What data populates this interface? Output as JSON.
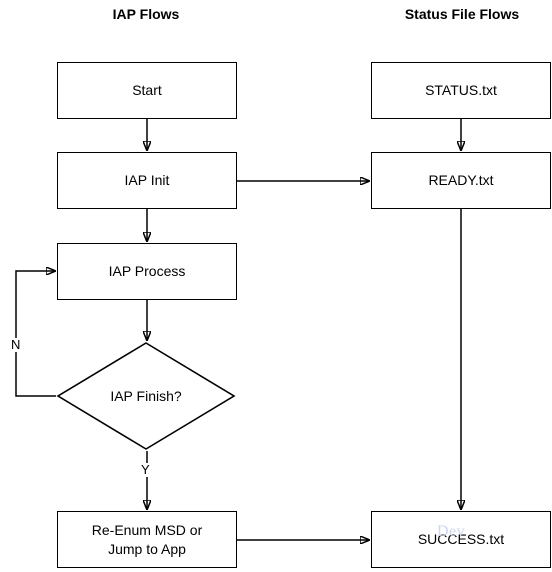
{
  "diagram": {
    "type": "flowchart",
    "background_color": "#ffffff",
    "stroke_color": "#000000",
    "columns": [
      {
        "id": "iap",
        "title": "IAP Flows"
      },
      {
        "id": "status",
        "title": "Status File Flows"
      }
    ],
    "nodes": {
      "start": {
        "label": "Start",
        "shape": "rectangle",
        "column": "iap"
      },
      "iap_init": {
        "label": "IAP Init",
        "shape": "rectangle",
        "column": "iap"
      },
      "iap_process": {
        "label": "IAP Process",
        "shape": "rectangle",
        "column": "iap"
      },
      "iap_finish": {
        "label": "IAP Finish?",
        "shape": "diamond",
        "column": "iap"
      },
      "reenum": {
        "label_line1": "Re-Enum MSD or",
        "label_line2": "Jump to App",
        "shape": "rectangle",
        "column": "iap"
      },
      "status_txt": {
        "label": "STATUS.txt",
        "shape": "rectangle",
        "column": "status"
      },
      "ready_txt": {
        "label": "READY.txt",
        "shape": "rectangle",
        "column": "status"
      },
      "success_txt": {
        "label": "SUCCESS.txt",
        "shape": "rectangle",
        "column": "status"
      }
    },
    "edge_labels": {
      "no": "N",
      "yes": "Y"
    },
    "watermark": "Dev"
  }
}
